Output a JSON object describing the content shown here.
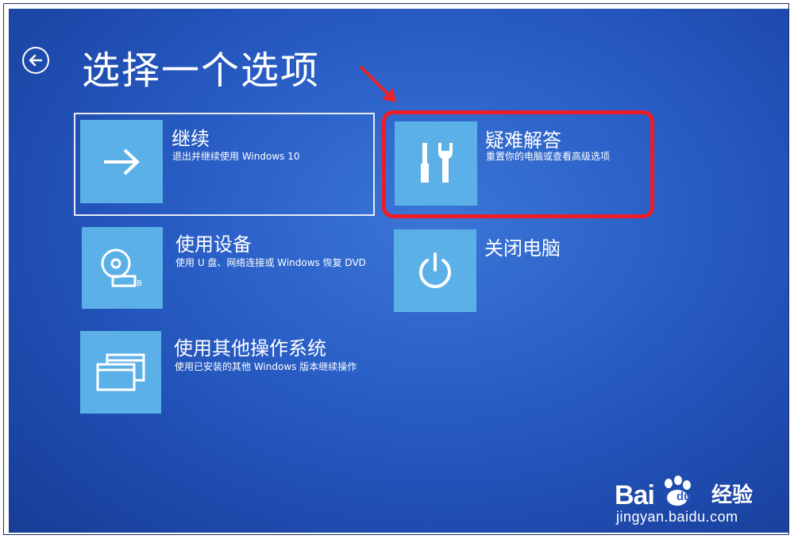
{
  "header": {
    "title": "选择一个选项",
    "back_icon": "back-arrow-circle-icon"
  },
  "options": [
    {
      "id": "continue",
      "label": "继续",
      "description": "退出并继续使用 Windows 10",
      "icon": "arrow-right-icon",
      "focused": true
    },
    {
      "id": "use-device",
      "label": "使用设备",
      "description": "使用 U 盘、网络连接或 Windows 恢复 DVD",
      "icon": "disc-drive-icon"
    },
    {
      "id": "other-os",
      "label": "使用其他操作系统",
      "description": "使用已安装的其他 Windows 版本继续操作",
      "icon": "windows-stack-icon"
    },
    {
      "id": "troubleshoot",
      "label": "疑难解答",
      "description": "重置你的电脑或查看高级选项",
      "icon": "tools-icon",
      "highlighted": true
    },
    {
      "id": "shutdown",
      "label": "关闭电脑",
      "description": "",
      "icon": "power-icon"
    }
  ],
  "watermark": {
    "brand": "Bai",
    "brand_suffix": "du",
    "cn": "经验",
    "url": "jingyan.baidu.com"
  },
  "colors": {
    "background": "#2a5fc7",
    "tile": "#5cb0e8",
    "highlight": "#ee1c24",
    "text": "#ffffff"
  }
}
